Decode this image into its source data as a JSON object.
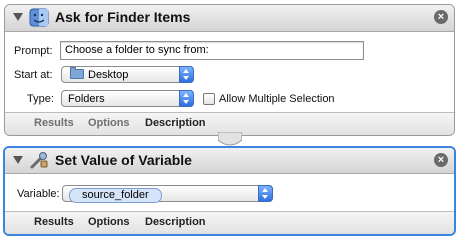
{
  "panel1": {
    "title": "Ask for Finder Items",
    "prompt_label": "Prompt:",
    "prompt_value": "Choose a folder to sync from:",
    "start_label": "Start at:",
    "start_value": "Desktop",
    "type_label": "Type:",
    "type_value": "Folders",
    "allow_multiple_label": "Allow Multiple Selection",
    "allow_multiple_checked": false,
    "tabs": [
      "Results",
      "Options",
      "Description"
    ]
  },
  "panel2": {
    "title": "Set Value of Variable",
    "variable_label": "Variable:",
    "variable_value": "source_folder",
    "tabs": [
      "Results",
      "Options",
      "Description"
    ]
  },
  "colors": {
    "selected_border": "#3d83e0",
    "popup_arrows": "#2d6fe0",
    "token_fill": "#d6e4fa"
  },
  "icons": [
    "disclosure-triangle-icon",
    "finder-icon",
    "close-icon",
    "folder-icon",
    "popup-arrows-icon",
    "variable-tool-icon"
  ]
}
